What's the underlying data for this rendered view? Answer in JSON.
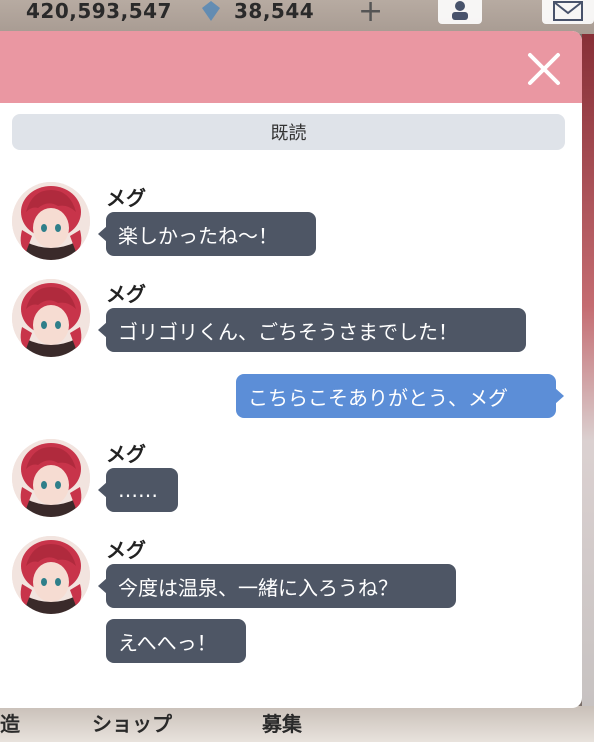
{
  "background": {
    "money": "420,593,547",
    "gems": "38,544",
    "plus_label": "+",
    "nav": [
      "造",
      "ショップ",
      "募集"
    ]
  },
  "dialog": {
    "read_status": "既読",
    "colors": {
      "header": "#ea97a2",
      "incoming_bubble": "#4e5665",
      "outgoing_bubble": "#5c8ed7",
      "read_bar": "#dfe3e9"
    },
    "messages": [
      {
        "sender": "メグ",
        "text": "楽しかったね～！",
        "direction": "incoming"
      },
      {
        "sender": "メグ",
        "text": "ゴリゴリくん、ごちそうさまでした！",
        "direction": "incoming"
      },
      {
        "sender": "",
        "text": "こちらこそありがとう、メグ",
        "direction": "outgoing"
      },
      {
        "sender": "メグ",
        "text": "……",
        "direction": "incoming"
      },
      {
        "sender": "メグ",
        "text": "今度は温泉、一緒に入ろうね？",
        "direction": "incoming"
      },
      {
        "sender": "",
        "text": "えへへっ！",
        "direction": "incoming-continued"
      }
    ]
  },
  "icons": {
    "close": "close-icon",
    "avatar": "avatar",
    "gem": "gem-icon",
    "profile": "profile-icon",
    "mail": "mail-icon"
  }
}
